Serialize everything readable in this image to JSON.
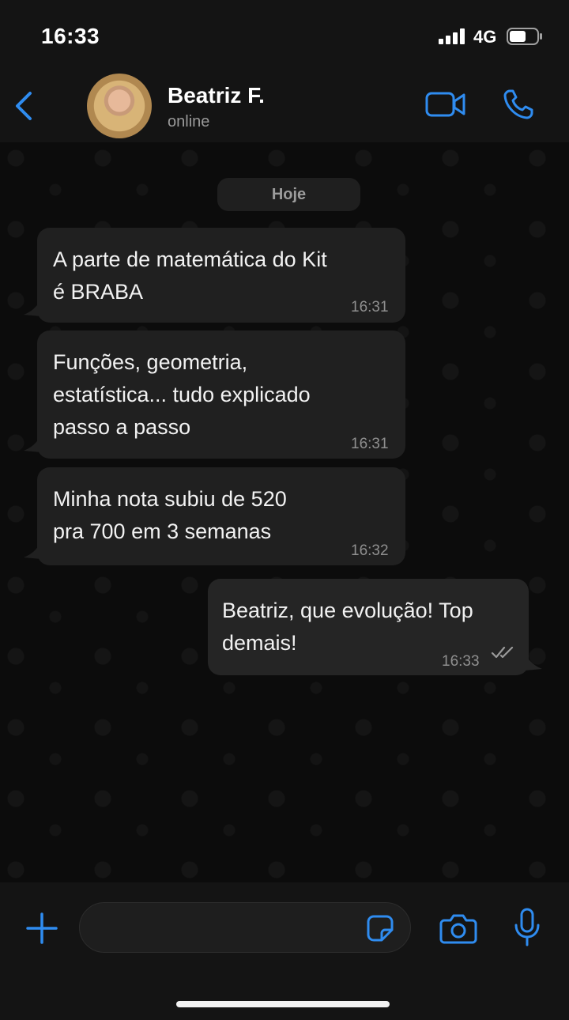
{
  "status_bar": {
    "time": "16:33",
    "network": "4G"
  },
  "contact": {
    "name": "Beatriz F.",
    "status": "online"
  },
  "chat": {
    "date_label": "Hoje",
    "messages": [
      {
        "direction": "incoming",
        "lines": [
          "A parte de matemática do Kit",
          "é BRABA"
        ],
        "time": "16:31"
      },
      {
        "direction": "incoming",
        "lines": [
          "Funções, geometria,",
          "estatística... tudo explicado",
          "passo a passo"
        ],
        "time": "16:31"
      },
      {
        "direction": "incoming",
        "lines": [
          "Minha nota subiu de 520",
          "pra 700 em 3 semanas"
        ],
        "time": "16:32"
      },
      {
        "direction": "outgoing",
        "lines": [
          "Beatriz, que evolução! Top",
          "demais!"
        ],
        "time": "16:33",
        "read": true
      }
    ]
  },
  "composer": {
    "placeholder": ""
  },
  "colors": {
    "accent": "#2f8cf0",
    "bubble_in": "#202020",
    "bubble_out": "#252525",
    "background": "#0c0c0c"
  }
}
